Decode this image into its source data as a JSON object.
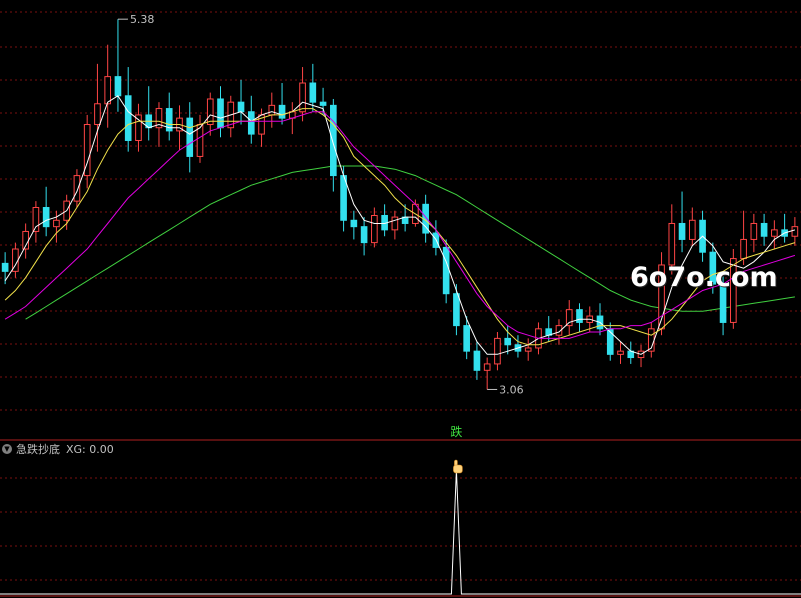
{
  "chart_data": [
    {
      "type": "candlestick",
      "panel": "price",
      "ylim": [
        2.9,
        5.45
      ],
      "grid": true,
      "colors": {
        "up": "#ff4545",
        "down": "#33e0ee",
        "ma5": "#ffffff",
        "ma10": "#f0e04a",
        "ma20": "#e000e0",
        "ma60": "#40d040",
        "grid": "#7a1010"
      },
      "candles": [
        [
          3.85,
          3.92,
          3.72,
          3.8
        ],
        [
          3.8,
          3.98,
          3.76,
          3.94
        ],
        [
          3.94,
          4.1,
          3.88,
          4.05
        ],
        [
          4.05,
          4.24,
          3.98,
          4.2
        ],
        [
          4.2,
          4.33,
          4.02,
          4.08
        ],
        [
          4.08,
          4.18,
          3.98,
          4.12
        ],
        [
          4.12,
          4.28,
          4.06,
          4.24
        ],
        [
          4.24,
          4.44,
          4.2,
          4.4
        ],
        [
          4.4,
          4.78,
          4.32,
          4.72
        ],
        [
          4.72,
          5.1,
          4.55,
          4.85
        ],
        [
          4.85,
          5.22,
          4.7,
          5.02
        ],
        [
          5.02,
          5.38,
          4.8,
          4.9
        ],
        [
          4.9,
          5.08,
          4.55,
          4.62
        ],
        [
          4.62,
          4.85,
          4.55,
          4.78
        ],
        [
          4.78,
          4.96,
          4.62,
          4.7
        ],
        [
          4.7,
          4.86,
          4.58,
          4.82
        ],
        [
          4.82,
          4.92,
          4.62,
          4.68
        ],
        [
          4.68,
          4.84,
          4.56,
          4.76
        ],
        [
          4.76,
          4.86,
          4.42,
          4.52
        ],
        [
          4.52,
          4.78,
          4.48,
          4.72
        ],
        [
          4.72,
          4.92,
          4.65,
          4.88
        ],
        [
          4.88,
          4.96,
          4.64,
          4.7
        ],
        [
          4.7,
          4.9,
          4.64,
          4.86
        ],
        [
          4.86,
          5.0,
          4.72,
          4.8
        ],
        [
          4.8,
          4.9,
          4.6,
          4.66
        ],
        [
          4.66,
          4.82,
          4.58,
          4.78
        ],
        [
          4.78,
          4.92,
          4.7,
          4.84
        ],
        [
          4.84,
          4.98,
          4.72,
          4.76
        ],
        [
          4.76,
          4.86,
          4.66,
          4.8
        ],
        [
          4.8,
          5.08,
          4.74,
          4.98
        ],
        [
          4.98,
          5.1,
          4.8,
          4.86
        ],
        [
          4.86,
          4.95,
          4.78,
          4.84
        ],
        [
          4.84,
          4.88,
          4.3,
          4.4
        ],
        [
          4.4,
          4.46,
          4.05,
          4.12
        ],
        [
          4.12,
          4.18,
          4.0,
          4.08
        ],
        [
          4.08,
          4.14,
          3.9,
          3.98
        ],
        [
          3.98,
          4.2,
          3.95,
          4.15
        ],
        [
          4.15,
          4.22,
          4.02,
          4.06
        ],
        [
          4.06,
          4.18,
          4.0,
          4.14
        ],
        [
          4.14,
          4.22,
          4.05,
          4.1
        ],
        [
          4.1,
          4.25,
          4.08,
          4.22
        ],
        [
          4.22,
          4.28,
          3.98,
          4.04
        ],
        [
          4.04,
          4.12,
          3.9,
          3.95
        ],
        [
          3.95,
          4.0,
          3.6,
          3.66
        ],
        [
          3.66,
          3.72,
          3.4,
          3.46
        ],
        [
          3.46,
          3.52,
          3.25,
          3.3
        ],
        [
          3.3,
          3.36,
          3.12,
          3.18
        ],
        [
          3.18,
          3.26,
          3.06,
          3.22
        ],
        [
          3.22,
          3.42,
          3.18,
          3.38
        ],
        [
          3.38,
          3.46,
          3.28,
          3.34
        ],
        [
          3.34,
          3.4,
          3.26,
          3.3
        ],
        [
          3.3,
          3.38,
          3.24,
          3.32
        ],
        [
          3.32,
          3.48,
          3.28,
          3.44
        ],
        [
          3.44,
          3.52,
          3.36,
          3.4
        ],
        [
          3.4,
          3.5,
          3.34,
          3.46
        ],
        [
          3.46,
          3.62,
          3.4,
          3.56
        ],
        [
          3.56,
          3.6,
          3.42,
          3.48
        ],
        [
          3.48,
          3.58,
          3.42,
          3.52
        ],
        [
          3.52,
          3.6,
          3.4,
          3.44
        ],
        [
          3.44,
          3.48,
          3.24,
          3.28
        ],
        [
          3.28,
          3.36,
          3.22,
          3.3
        ],
        [
          3.3,
          3.36,
          3.22,
          3.26
        ],
        [
          3.26,
          3.34,
          3.2,
          3.3
        ],
        [
          3.3,
          3.48,
          3.26,
          3.44
        ],
        [
          3.44,
          3.92,
          3.4,
          3.84
        ],
        [
          3.84,
          4.22,
          3.78,
          4.1
        ],
        [
          4.1,
          4.3,
          3.92,
          4.0
        ],
        [
          4.0,
          4.2,
          3.96,
          4.12
        ],
        [
          4.12,
          4.18,
          3.86,
          3.92
        ],
        [
          3.92,
          3.98,
          3.66,
          3.72
        ],
        [
          3.72,
          3.78,
          3.4,
          3.48
        ],
        [
          3.48,
          3.94,
          3.44,
          3.88
        ],
        [
          3.88,
          4.18,
          3.84,
          4.0
        ],
        [
          4.0,
          4.16,
          3.92,
          4.1
        ],
        [
          4.1,
          4.16,
          3.96,
          4.02
        ],
        [
          4.02,
          4.12,
          3.94,
          4.06
        ],
        [
          4.06,
          4.16,
          3.98,
          4.02
        ],
        [
          4.02,
          4.14,
          3.96,
          4.08
        ]
      ],
      "ma_series": [
        {
          "name": "MA5",
          "color": "#ffffff",
          "values": [
            3.74,
            3.84,
            3.96,
            4.08,
            4.12,
            4.14,
            4.18,
            4.3,
            4.48,
            4.68,
            4.86,
            4.9,
            4.8,
            4.75,
            4.7,
            4.72,
            4.7,
            4.7,
            4.66,
            4.7,
            4.78,
            4.76,
            4.78,
            4.8,
            4.74,
            4.78,
            4.8,
            4.78,
            4.8,
            4.86,
            4.84,
            4.82,
            4.6,
            4.4,
            4.22,
            4.12,
            4.1,
            4.1,
            4.12,
            4.14,
            4.14,
            4.08,
            4.0,
            3.86,
            3.68,
            3.5,
            3.36,
            3.28,
            3.28,
            3.3,
            3.32,
            3.34,
            3.38,
            3.4,
            3.42,
            3.48,
            3.5,
            3.5,
            3.48,
            3.42,
            3.36,
            3.3,
            3.28,
            3.32,
            3.5,
            3.7,
            3.84,
            3.96,
            4.02,
            3.96,
            3.86,
            3.84,
            3.82,
            3.86,
            3.92,
            4.0,
            4.04,
            4.06
          ]
        },
        {
          "name": "MA10",
          "color": "#f0e04a",
          "values": [
            3.62,
            3.68,
            3.76,
            3.86,
            3.96,
            4.04,
            4.1,
            4.2,
            4.3,
            4.44,
            4.56,
            4.66,
            4.72,
            4.74,
            4.74,
            4.74,
            4.72,
            4.72,
            4.7,
            4.72,
            4.74,
            4.74,
            4.74,
            4.74,
            4.74,
            4.76,
            4.78,
            4.78,
            4.8,
            4.82,
            4.82,
            4.78,
            4.72,
            4.64,
            4.52,
            4.46,
            4.4,
            4.34,
            4.26,
            4.2,
            4.16,
            4.12,
            4.06,
            3.98,
            3.9,
            3.8,
            3.7,
            3.6,
            3.5,
            3.42,
            3.36,
            3.34,
            3.34,
            3.36,
            3.38,
            3.4,
            3.42,
            3.44,
            3.46,
            3.46,
            3.46,
            3.44,
            3.42,
            3.4,
            3.44,
            3.5,
            3.58,
            3.66,
            3.74,
            3.78,
            3.8,
            3.84,
            3.88,
            3.9,
            3.92,
            3.94,
            3.96,
            3.98
          ]
        },
        {
          "name": "MA20",
          "color": "#e000e0",
          "values": [
            3.5,
            3.54,
            3.58,
            3.64,
            3.7,
            3.76,
            3.82,
            3.88,
            3.94,
            4.02,
            4.1,
            4.18,
            4.26,
            4.32,
            4.38,
            4.44,
            4.5,
            4.56,
            4.6,
            4.64,
            4.68,
            4.7,
            4.72,
            4.74,
            4.74,
            4.74,
            4.74,
            4.74,
            4.76,
            4.78,
            4.8,
            4.8,
            4.74,
            4.66,
            4.58,
            4.52,
            4.46,
            4.4,
            4.34,
            4.28,
            4.22,
            4.14,
            4.06,
            3.96,
            3.86,
            3.76,
            3.66,
            3.58,
            3.52,
            3.46,
            3.42,
            3.4,
            3.38,
            3.38,
            3.38,
            3.38,
            3.4,
            3.42,
            3.42,
            3.44,
            3.44,
            3.46,
            3.46,
            3.48,
            3.52,
            3.56,
            3.6,
            3.64,
            3.68,
            3.7,
            3.72,
            3.76,
            3.8,
            3.82,
            3.84,
            3.86,
            3.88,
            3.9
          ]
        },
        {
          "name": "MA60",
          "color": "#40d040",
          "values": [
            null,
            null,
            3.5,
            3.54,
            3.58,
            3.62,
            3.66,
            3.7,
            3.74,
            3.78,
            3.82,
            3.86,
            3.9,
            3.94,
            3.98,
            4.02,
            4.06,
            4.1,
            4.14,
            4.18,
            4.22,
            4.25,
            4.28,
            4.31,
            4.34,
            4.36,
            4.38,
            4.4,
            4.42,
            4.43,
            4.44,
            4.45,
            4.46,
            4.46,
            4.46,
            4.46,
            4.46,
            4.45,
            4.44,
            4.42,
            4.4,
            4.37,
            4.34,
            4.31,
            4.28,
            4.24,
            4.2,
            4.16,
            4.12,
            4.08,
            4.04,
            4.0,
            3.96,
            3.92,
            3.88,
            3.84,
            3.8,
            3.76,
            3.72,
            3.68,
            3.65,
            3.62,
            3.6,
            3.58,
            3.57,
            3.56,
            3.55,
            3.55,
            3.55,
            3.56,
            3.57,
            3.58,
            3.59,
            3.6,
            3.61,
            3.62,
            3.63,
            3.64
          ]
        }
      ],
      "annotations": [
        {
          "text": "5.38",
          "candle": 11,
          "price": 5.38
        },
        {
          "text": "3.06",
          "candle": 47,
          "price": 3.06
        },
        {
          "text": "跌",
          "candle": 44
        }
      ]
    },
    {
      "type": "line",
      "panel": "indicator",
      "title": "急跌抄底",
      "series": [
        {
          "name": "XG",
          "value_label": "0.00",
          "color": "#ffffff",
          "signal_candle": 44,
          "signal_value": 1
        }
      ],
      "ylim": [
        0,
        1
      ]
    }
  ],
  "watermark": "6o7o.com",
  "indicator_panel": {
    "title": "急跌抄底",
    "xg_label": "XG: 0.00"
  }
}
